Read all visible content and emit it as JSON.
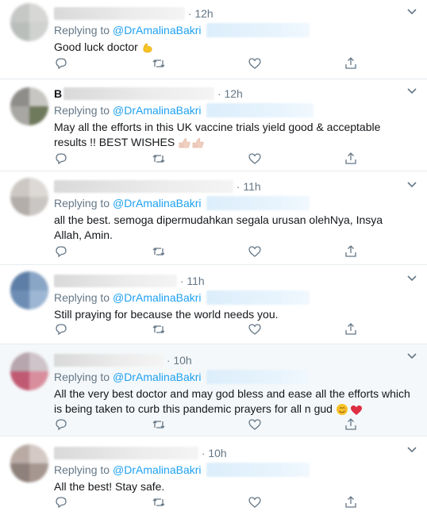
{
  "tweets": [
    {
      "name_initial": "",
      "time": "12h",
      "replying_label": "Replying to",
      "handle": "@DrAmalinaBakri",
      "text": "Good luck doctor",
      "emoji": "flexed-biceps",
      "highlighted": false,
      "avatar_colors": [
        "#c6c8c6",
        "#d7d7d6",
        "#b9bebb",
        "#cfd2cf"
      ]
    },
    {
      "name_initial": "B",
      "time": "12h",
      "replying_label": "Replying to",
      "handle": "@DrAmalinaBakri",
      "text": "May all the efforts in this UK vaccine trials yield good & acceptable results !! BEST WISHES",
      "emoji": "thumbs-up",
      "highlighted": false,
      "avatar_colors": [
        "#8f8d8a",
        "#c8c6c2",
        "#a9a7a3",
        "#6f7a5c"
      ]
    },
    {
      "name_initial": "",
      "time": "11h",
      "replying_label": "Replying to",
      "handle": "@DrAmalinaBakri",
      "text": "all the best. semoga dipermudahkan segala urusan olehNya, Insya Allah, Amin.",
      "emoji": "",
      "highlighted": false,
      "avatar_colors": [
        "#cdc8c4",
        "#ddd9d6",
        "#b4aeaa",
        "#cac6c3"
      ]
    },
    {
      "name_initial": "",
      "time": "11h",
      "replying_label": "Replying to",
      "handle": "@DrAmalinaBakri",
      "text": "Still praying for because the world needs you.",
      "emoji": "",
      "highlighted": false,
      "avatar_colors": [
        "#5d7ea6",
        "#8aa6c6",
        "#6d8db4",
        "#9cb6d3"
      ]
    },
    {
      "name_initial": "",
      "time": "10h",
      "replying_label": "Replying to",
      "handle": "@DrAmalinaBakri",
      "text": "All the very best doctor and may god bless and ease all the efforts which is being taken to curb this pandemic prayers for all n gud",
      "emoji": "smile-heart",
      "highlighted": true,
      "avatar_colors": [
        "#b7a6ad",
        "#cfc4c9",
        "#c05a73",
        "#d98e9e"
      ]
    },
    {
      "name_initial": "",
      "time": "10h",
      "replying_label": "Replying to",
      "handle": "@DrAmalinaBakri",
      "text": "All the best! Stay safe.",
      "emoji": "",
      "highlighted": false,
      "avatar_colors": [
        "#b9aba4",
        "#d4c9c4",
        "#8e807a",
        "#a69790"
      ]
    }
  ],
  "icons": {
    "reply": "reply-icon",
    "retweet": "retweet-icon",
    "like": "heart-icon",
    "share": "share-icon",
    "menu": "chevron-down-icon"
  },
  "colors": {
    "link": "#1da1f2",
    "secondary": "#657786",
    "divider": "#e6ecf0",
    "highlight_bg": "#f5f8fa"
  }
}
